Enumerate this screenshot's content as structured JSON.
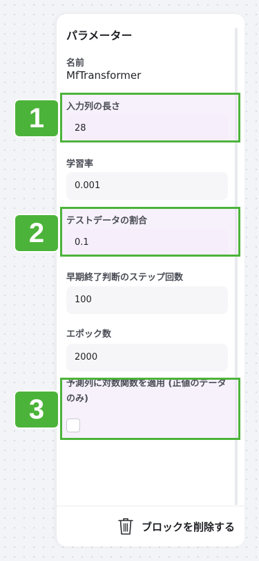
{
  "panel": {
    "title": "パラメーター",
    "name_label": "名前",
    "name_value": "MfTransformer"
  },
  "fields": [
    {
      "label": "入力列の長さ",
      "value": "28"
    },
    {
      "label": "学習率",
      "value": "0.001"
    },
    {
      "label": "テストデータの割合",
      "value": "0.1"
    },
    {
      "label": "早期終了判断のステップ回数",
      "value": "100"
    },
    {
      "label": "エポック数",
      "value": "2000"
    }
  ],
  "log_option": {
    "label": "予測列に対数関数を適用 (正値のデータのみ)",
    "checked": false
  },
  "badges": [
    "1",
    "2",
    "3"
  ],
  "footer": {
    "delete_label": "ブロックを削除する",
    "delete_icon": "trash-icon"
  },
  "colors": {
    "highlight": "#4cb33a",
    "highlight_fill": "#f6eefb"
  }
}
